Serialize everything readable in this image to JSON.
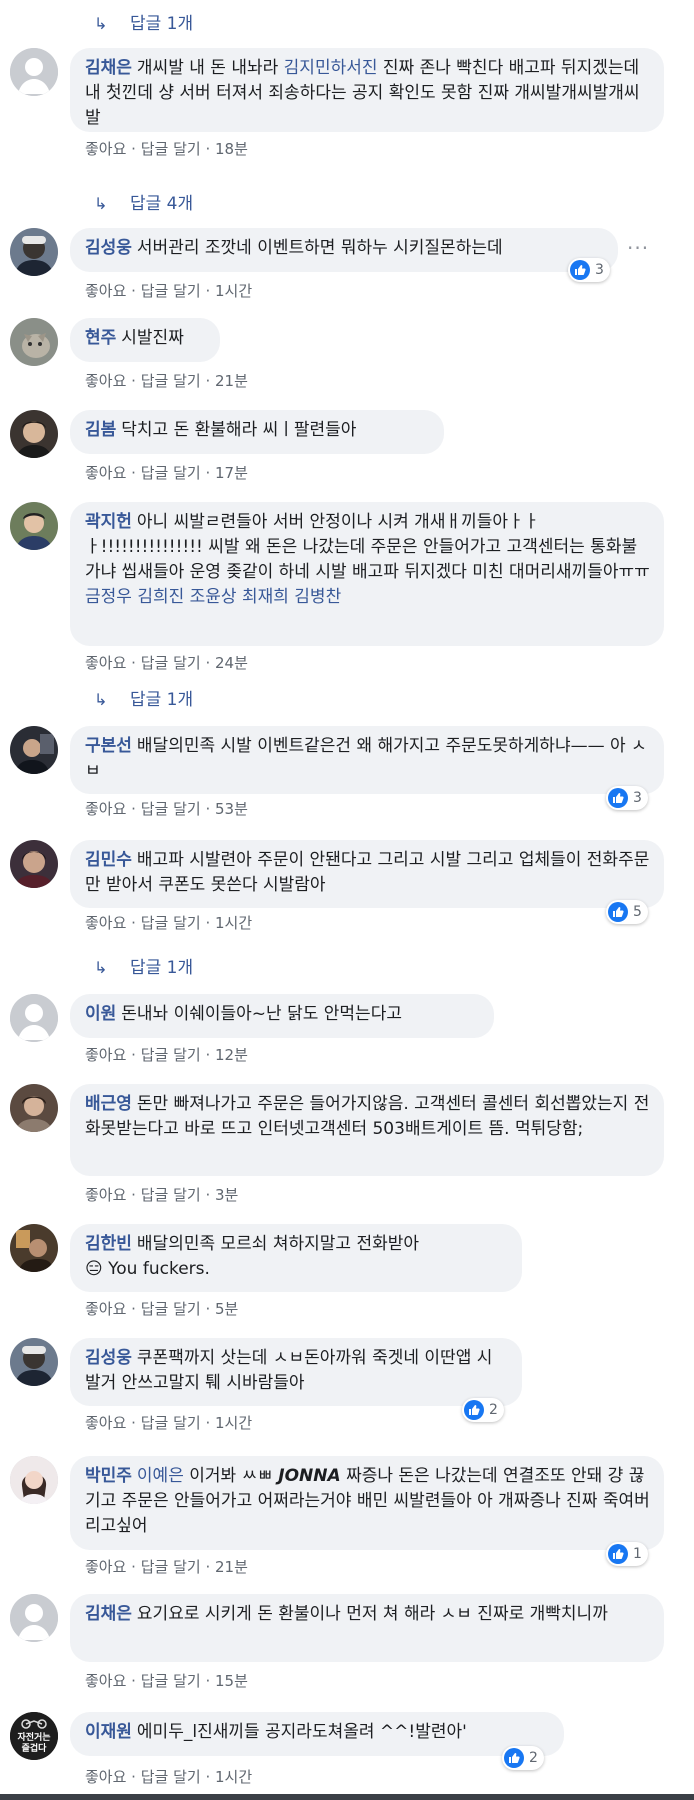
{
  "actions": {
    "like": "좋아요",
    "dot": " · ",
    "reply": "답글 달기"
  },
  "reply_toggles": [
    "답글 1개",
    "답글 4개",
    "답글 1개",
    "답글 1개"
  ],
  "comments": [
    {
      "author": "김채은",
      "tag": "김지민하서진",
      "text_before": "개씨발 내 돈 내놔라",
      "text_after": "진짜 존나 빡친다 배고파 뒤지겠는데 내 첫낀데 샹 서버 터져서 죄송하다는 공지 확인도 못함 진짜 개씨발개씨발개씨발",
      "time": "18분"
    },
    {
      "author": "김성웅",
      "text": "서버관리 조깟네 이벤트하면 뭐하누 시키질몬하는데",
      "time": "1시간",
      "likes": "3"
    },
    {
      "author": "현주",
      "text": "시발진짜",
      "time": "21분"
    },
    {
      "author": "김봄",
      "text": "닥치고 돈 환불해라 씨ㅣ팔련들아",
      "time": "17분"
    },
    {
      "author": "곽지헌",
      "text": "아니 씨발ㄹ련들아 서버 안정이나 시켜 개새ㅐ끼들아ㅏㅏㅏ!!!!!!!!!!!!!!! 씨발 왜 돈은 나갔는데 주문은 안들어가고 고객센터는 통화불가냐 씹새들아 운영 좆같이 하네 시발 배고파 뒤지겠다 미친 대머리새끼들아ㅠㅠ",
      "tags": "금정우 김희진 조윤상 최재희 김병찬",
      "time": "24분"
    },
    {
      "author": "구본선",
      "text": "배달의민족 시발 이벤트같은건 왜 해가지고 주문도못하게하냐—— 아 ㅅㅂ",
      "time": "53분",
      "likes": "3"
    },
    {
      "author": "김민수",
      "text": "배고파 시발련아 주문이 안됀다고 그리고 시발 그리고 업체들이 전화주문만 받아서 쿠폰도 못쓴다 시발람아",
      "time": "1시간",
      "likes": "5"
    },
    {
      "author": "이원",
      "text": "돈내놔 이쉐이들아~난 닭도 안먹는다고",
      "time": "12분"
    },
    {
      "author": "배근영",
      "text": "돈만 빠져나가고 주문은 들어가지않음. 고객센터 콜센터 회선뽑았는지 전화못받는다고 바로 뜨고 인터넷고객센터 503배트게이트 뜸. 먹튀당함;",
      "time": "3분"
    },
    {
      "author": "김한빈",
      "text": "배달의민족 모르쇠 쳐하지말고 전화받아",
      "emoji": "😑",
      "text2": "You fuckers.",
      "time": "5분"
    },
    {
      "author": "김성웅",
      "text": "쿠폰팩까지 삿는데 ㅅㅂ돈아까워 죽겟네 이딴앱 시발거 안쓰고말지 퉤 시바람들아",
      "time": "1시간",
      "likes": "2"
    },
    {
      "author": "박민주",
      "tag": "이예은",
      "text_a": "이거봐 ㅆㅃ",
      "text_b": "JONNA",
      "text_c": "짜증나 돈은 나갔는데 연결조또 안돼 걍 끊기고 주문은 안들어가고 어쩌라는거야 배민 씨발련들아 아 개짜증나 진짜 죽여버리고싶어",
      "time": "21분",
      "likes": "1"
    },
    {
      "author": "김채은",
      "text": "요기요로 시키게 돈 환불이나 먼저 쳐 해라 ㅅㅂ 진짜로 개빡치니까",
      "time": "15분"
    },
    {
      "author": "이재원",
      "text": "에미두_l진새끼들 공지라도쳐올려 ^^!발련아'",
      "avatar_text": "자전거는 즐겁다",
      "time": "1시간",
      "likes": "2"
    }
  ]
}
